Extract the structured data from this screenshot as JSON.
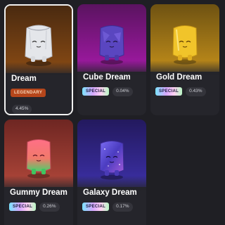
{
  "cards": [
    {
      "name": "Dream",
      "badge": "LEGENDARY",
      "percent": "4.45%",
      "colors": {
        "top": "#5a3312",
        "bottom": "#8f4d12",
        "body": "#e4e6ea"
      }
    },
    {
      "name": "Cube Dream",
      "badge": "SPECIAL",
      "percent": "0.04%",
      "colors": {
        "top": "#6a1a6e",
        "bottom": "#a01aa8",
        "body": "#6a4fc8"
      }
    },
    {
      "name": "Gold Dream",
      "badge": "SPECIAL",
      "percent": "0.43%",
      "colors": {
        "top": "#7a5a12",
        "bottom": "#c9951b",
        "body": "#f2c52a"
      }
    },
    {
      "name": "Gummy Dream",
      "badge": "SPECIAL",
      "percent": "0.26%",
      "colors": {
        "top": "#7a2a25",
        "bottom": "#b44537",
        "body": "#f0707a"
      }
    },
    {
      "name": "Galaxy Dream",
      "badge": "SPECIAL",
      "percent": "0.17%",
      "colors": {
        "top": "#2a1f6e",
        "bottom": "#3b2fa3",
        "body": "#5b4fd0"
      }
    }
  ]
}
